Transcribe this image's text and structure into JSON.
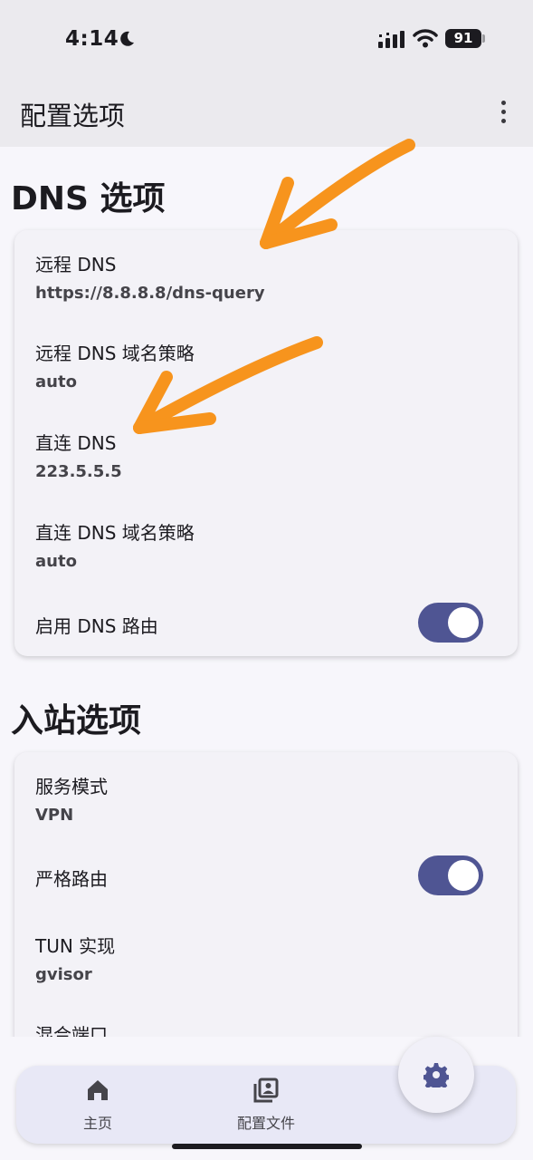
{
  "status_bar": {
    "time": "4:14",
    "battery": "91"
  },
  "app_bar": {
    "title": "配置选项"
  },
  "dns_section": {
    "title": "DNS 选项",
    "remote_dns": {
      "label": "远程 DNS",
      "value": "https://8.8.8.8/dns-query"
    },
    "remote_dns_strategy": {
      "label": "远程 DNS 域名策略",
      "value": "auto"
    },
    "direct_dns": {
      "label": "直连 DNS",
      "value": "223.5.5.5"
    },
    "direct_dns_strategy": {
      "label": "直连 DNS 域名策略",
      "value": "auto"
    },
    "enable_dns_routing": {
      "label": "启用 DNS 路由",
      "enabled": true
    }
  },
  "inbound_section": {
    "title": "入站选项",
    "service_mode": {
      "label": "服务模式",
      "value": "VPN"
    },
    "strict_route": {
      "label": "严格路由",
      "enabled": true
    },
    "tun_impl": {
      "label": "TUN 实现",
      "value": "gvisor"
    },
    "mixed_port": {
      "label": "混合端口"
    }
  },
  "bottom_nav": {
    "home": {
      "label": "主页",
      "icon": "home-icon"
    },
    "profiles": {
      "label": "配置文件",
      "icon": "profiles-icon"
    },
    "fab_icon": "gear-icon"
  },
  "colors": {
    "accent": "#4f5593",
    "arrow": "#f7941d",
    "bar": "#ebeaee"
  }
}
